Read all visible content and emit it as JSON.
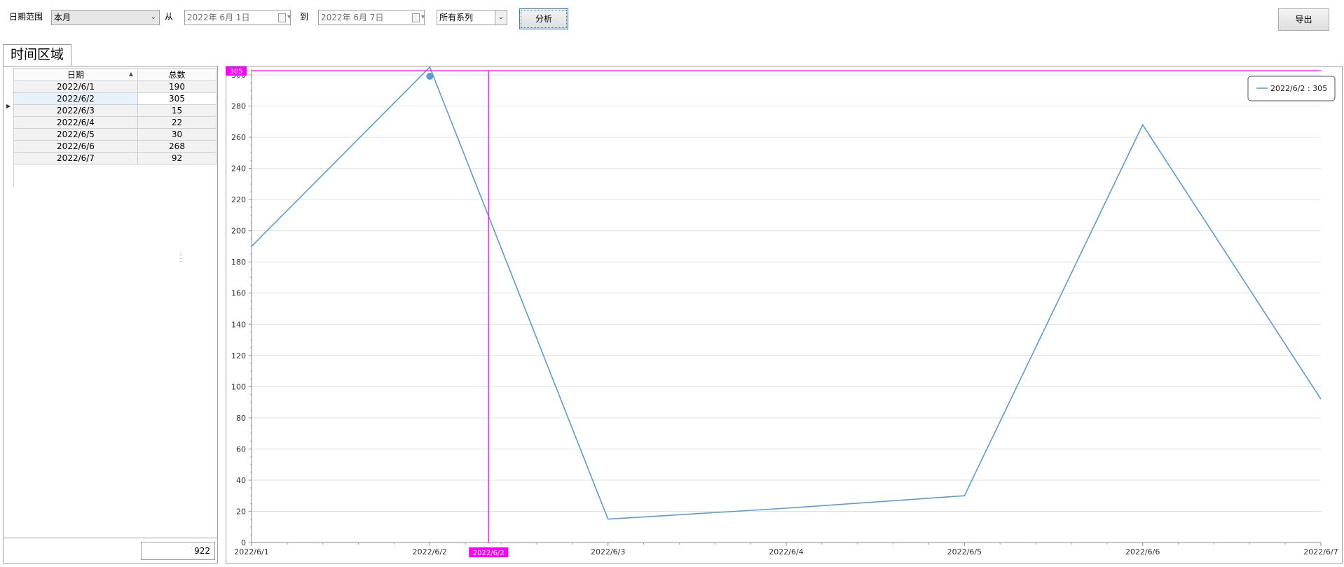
{
  "toolbar": {
    "date_range_label": "日期范围",
    "date_range_value": "本月",
    "from_label": "从",
    "from_date": "2022年  6月  1日",
    "to_label": "到",
    "to_date": "2022年  6月  7日",
    "series_value": "所有系列",
    "analyze_label": "分析",
    "export_label": "导出"
  },
  "tab": {
    "label": "时间区域"
  },
  "grid": {
    "columns": [
      "日期",
      "总数"
    ],
    "rows": [
      {
        "date": "2022/6/1",
        "total": "190"
      },
      {
        "date": "2022/6/2",
        "total": "305"
      },
      {
        "date": "2022/6/3",
        "total": "15"
      },
      {
        "date": "2022/6/4",
        "total": "22"
      },
      {
        "date": "2022/6/5",
        "total": "30"
      },
      {
        "date": "2022/6/6",
        "total": "268"
      },
      {
        "date": "2022/6/7",
        "total": "92"
      }
    ],
    "selected_index": 1,
    "footer_total": "922"
  },
  "chart_data": {
    "type": "line",
    "x": [
      "2022/6/1",
      "2022/6/2",
      "2022/6/3",
      "2022/6/4",
      "2022/6/5",
      "2022/6/6",
      "2022/6/7"
    ],
    "series": [
      {
        "values": [
          190,
          305,
          15,
          22,
          30,
          268,
          92
        ],
        "color": "#5b9bd5"
      }
    ],
    "x_tick_labels": [
      "2022/6/1",
      "2022/6/2",
      "2022/6/3",
      "2022/6/4",
      "2022/6/5",
      "2022/6/6",
      "2022/6/7"
    ],
    "y_ticks": [
      0,
      20,
      40,
      60,
      80,
      100,
      120,
      140,
      160,
      180,
      200,
      220,
      240,
      260,
      280,
      300
    ],
    "ylim": [
      0,
      300
    ],
    "grid": true,
    "crosshair": {
      "x_label": "2022/6/2",
      "y_label": "305",
      "y_value": 305,
      "x_value": 1.33,
      "color": "#ff00ff"
    },
    "highlight_point": {
      "x": "2022/6/2",
      "y": 305
    },
    "tooltip": "2022/6/2 : 305",
    "tooltip_placement": "top-right"
  }
}
